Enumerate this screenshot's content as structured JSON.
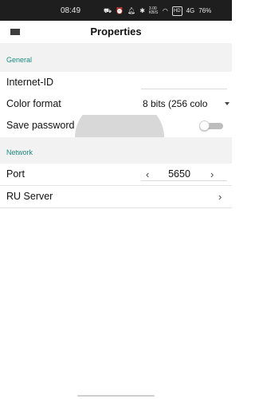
{
  "status_bar": {
    "time": "08:49",
    "icons": [
      "car-icon",
      "alarm-icon",
      "bell-icon",
      "bluetooth-icon"
    ],
    "data_rate": "3.00 KB/S",
    "wifi": "wifi-icon",
    "hd_badge": "HD",
    "signal": "4G",
    "battery": "76%"
  },
  "app_bar": {
    "title": "Properties",
    "menu_icon": "menu-icon"
  },
  "sections": {
    "general": {
      "title": "General",
      "internet_id": {
        "label": "Internet-ID",
        "value": ""
      },
      "color_format": {
        "label": "Color format",
        "value": "8 bits (256 colo"
      },
      "save_password": {
        "label": "Save password",
        "enabled": false
      }
    },
    "network": {
      "title": "Network",
      "port": {
        "label": "Port",
        "value": "5650",
        "decrement": "‹",
        "increment": "›"
      },
      "ru_server": {
        "label": "RU Server",
        "chevron": "›"
      }
    }
  },
  "colors": {
    "accent": "#1b8a7d",
    "section_bg": "#f2f2f2",
    "status_bg": "#1e1e1e"
  }
}
